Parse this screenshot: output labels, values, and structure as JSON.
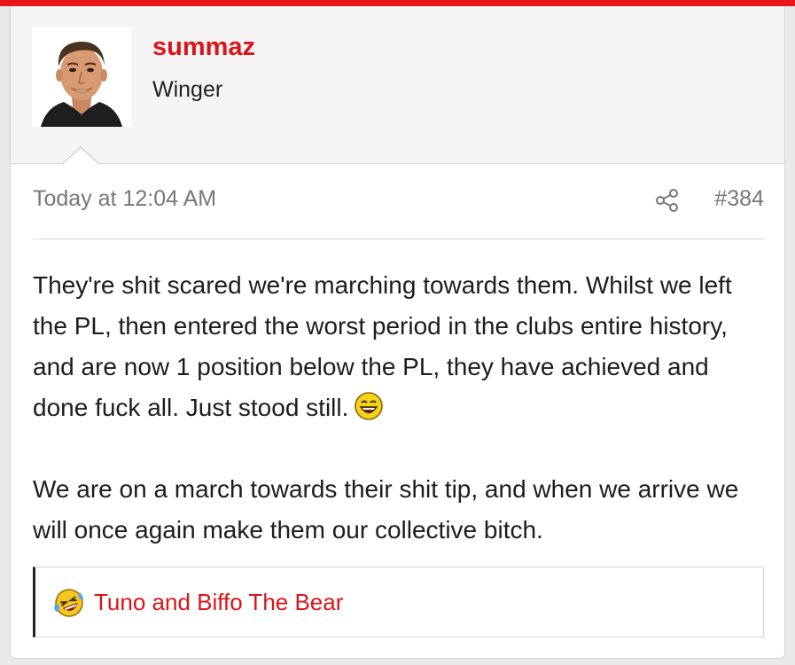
{
  "post": {
    "username": "summaz",
    "user_title": "Winger",
    "timestamp": "Today at 12:04 AM",
    "post_number": "#384",
    "paragraph1": "They're shit scared we're marching towards them. Whilst we left the PL, then entered the worst period in the clubs entire history, and are now 1 position below the PL, they have achieved and done fuck all. Just stood still.",
    "paragraph2": "We are on a march towards their shit tip, and when we arrive we will once again make them our collective bitch.",
    "inline_emoji": "laughing-face-icon",
    "share_icon": "share-icon"
  },
  "reactions": {
    "icon": "crying-laughing-icon",
    "text": "Tuno and Biffo The Bear"
  },
  "colors": {
    "accent": "#e8151b",
    "username": "#d9141a",
    "link": "#d9141a",
    "meta_text": "#777777",
    "body_text": "#1d1d1d"
  }
}
